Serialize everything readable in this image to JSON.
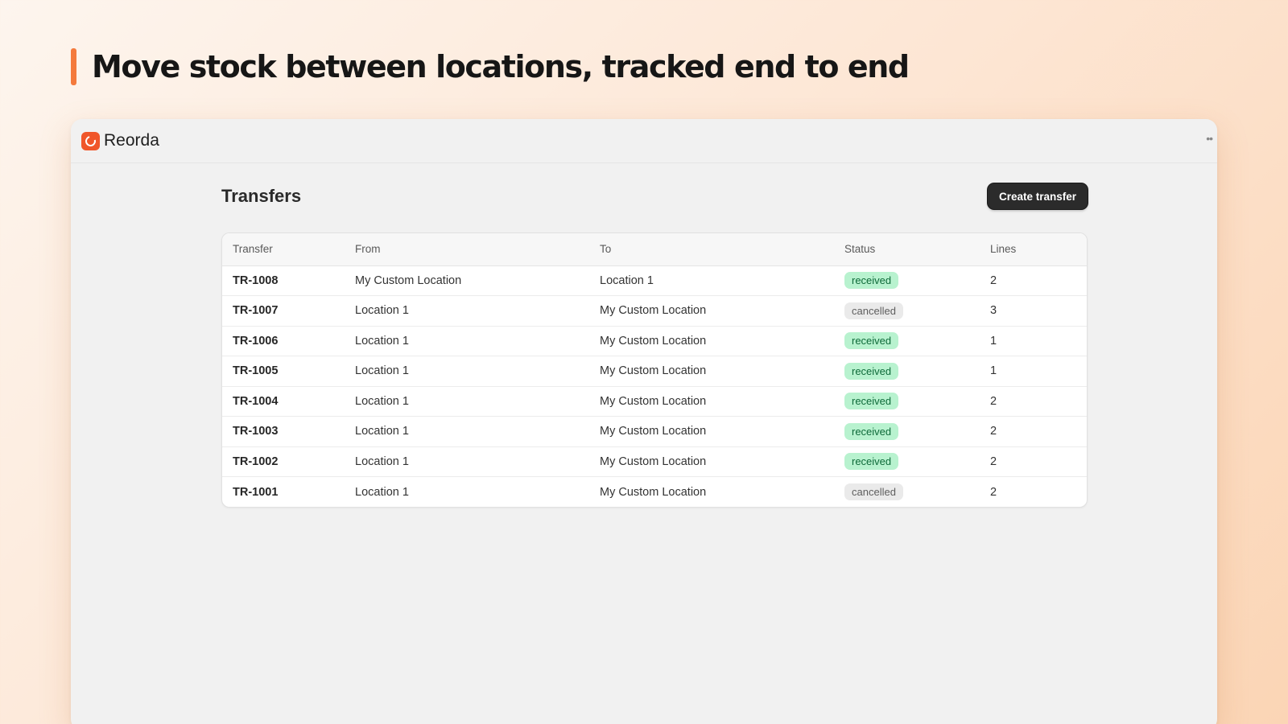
{
  "headline": "Move stock between locations, tracked end to end",
  "app": {
    "name": "Reorda",
    "more_icon": "more-dots-icon"
  },
  "page": {
    "title": "Transfers",
    "create_button": "Create transfer"
  },
  "table": {
    "columns": [
      "Transfer",
      "From",
      "To",
      "Status",
      "Lines"
    ],
    "rows": [
      {
        "id": "TR-1008",
        "from": "My Custom Location",
        "to": "Location 1",
        "status": "received",
        "lines": "2"
      },
      {
        "id": "TR-1007",
        "from": "Location 1",
        "to": "My Custom Location",
        "status": "cancelled",
        "lines": "3"
      },
      {
        "id": "TR-1006",
        "from": "Location 1",
        "to": "My Custom Location",
        "status": "received",
        "lines": "1"
      },
      {
        "id": "TR-1005",
        "from": "Location 1",
        "to": "My Custom Location",
        "status": "received",
        "lines": "1"
      },
      {
        "id": "TR-1004",
        "from": "Location 1",
        "to": "My Custom Location",
        "status": "received",
        "lines": "2"
      },
      {
        "id": "TR-1003",
        "from": "Location 1",
        "to": "My Custom Location",
        "status": "received",
        "lines": "2"
      },
      {
        "id": "TR-1002",
        "from": "Location 1",
        "to": "My Custom Location",
        "status": "received",
        "lines": "2"
      },
      {
        "id": "TR-1001",
        "from": "Location 1",
        "to": "My Custom Location",
        "status": "cancelled",
        "lines": "2"
      }
    ]
  },
  "colors": {
    "accent": "#f47a3c",
    "brand": "#f0562a",
    "received_bg": "#b8f2cf",
    "received_text": "#0e6a39",
    "cancelled_bg": "#eaeaea",
    "cancelled_text": "#5e5e5e"
  }
}
